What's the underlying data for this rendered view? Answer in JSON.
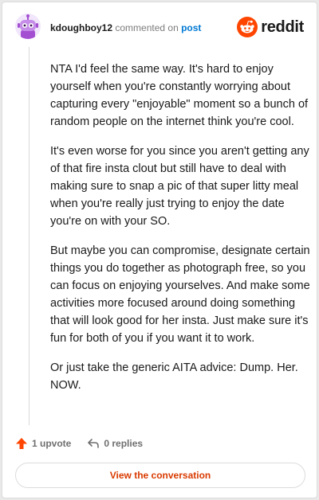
{
  "header": {
    "username": "kdoughboy12",
    "action_text": "commented on",
    "post_link": "post",
    "brand": "reddit"
  },
  "comment": {
    "paragraphs": [
      "NTA I'd feel the same way. It's hard to enjoy yourself when you're constantly worrying about capturing every \"enjoyable\" moment so a bunch of random people on the internet think you're cool.",
      "It's even worse for you since you aren't getting any of that fire insta clout but still have to deal with making sure to snap a pic of that super litty meal when you're really just trying to enjoy the date you're on with your SO.",
      "But maybe you can compromise, designate certain things you do together as photograph free, so you can focus on enjoying yourselves. And make some activities more focused around doing something that will look good for her insta. Just make sure it's fun for both of you if you want it to work.",
      "Or just take the generic AITA advice: Dump. Her. NOW."
    ]
  },
  "footer": {
    "upvotes": "1 upvote",
    "replies": "0 replies",
    "view_button": "View the conversation"
  },
  "colors": {
    "accent": "#d93a00",
    "upvote": "#ff4500",
    "link": "#0079d3",
    "avatar_bg": "#f1e6fb",
    "snoo": "#a44fd2"
  },
  "icons": {
    "avatar": "snoo-avatar-icon",
    "logo": "reddit-logo-icon",
    "upvote": "upvote-arrow-icon",
    "reply": "reply-arrow-icon"
  }
}
